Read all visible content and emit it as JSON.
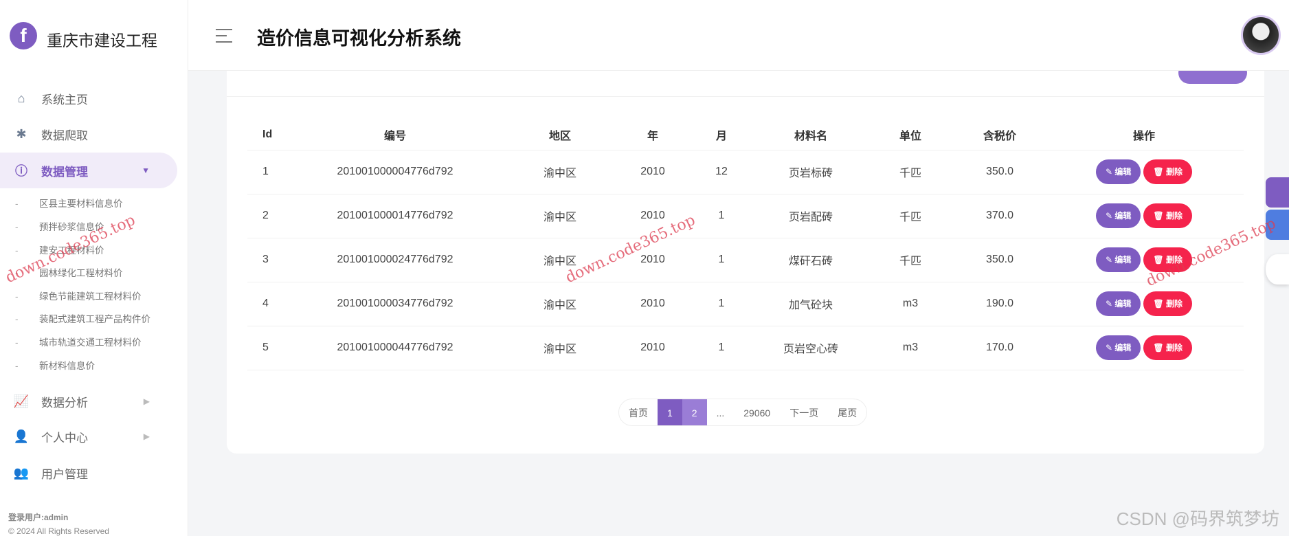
{
  "sidebar": {
    "logo_letter": "f",
    "brand": "重庆市建设工程",
    "items": [
      {
        "label": "系统主页"
      },
      {
        "label": "数据爬取"
      },
      {
        "label": "数据管理"
      },
      {
        "label": "数据分析"
      },
      {
        "label": "个人中心"
      },
      {
        "label": "用户管理"
      }
    ],
    "submenu": [
      "区县主要材料信息价",
      "预拌砂浆信息价",
      "建安工程材料价",
      "园林绿化工程材料价",
      "绿色节能建筑工程材料价",
      "装配式建筑工程产品构件价",
      "城市轨道交通工程材料价",
      "新材料信息价"
    ],
    "login_user": "登录用户:admin",
    "copyright": "© 2024 All Rights Reserved"
  },
  "header": {
    "title": "造价信息可视化分析系统"
  },
  "table": {
    "columns": [
      "Id",
      "编号",
      "地区",
      "年",
      "月",
      "材料名",
      "单位",
      "含税价",
      "操作"
    ],
    "rows": [
      [
        "1",
        "201001000004776d792",
        "渝中区",
        "2010",
        "12",
        "页岩标砖",
        "千匹",
        "350.0"
      ],
      [
        "2",
        "201001000014776d792",
        "渝中区",
        "2010",
        "1",
        "页岩配砖",
        "千匹",
        "370.0"
      ],
      [
        "3",
        "201001000024776d792",
        "渝中区",
        "2010",
        "1",
        "煤矸石砖",
        "千匹",
        "350.0"
      ],
      [
        "4",
        "201001000034776d792",
        "渝中区",
        "2010",
        "1",
        "加气砼块",
        "m3",
        "190.0"
      ],
      [
        "5",
        "201001000044776d792",
        "渝中区",
        "2010",
        "1",
        "页岩空心砖",
        "m3",
        "170.0"
      ]
    ],
    "edit_label": "✎ 编辑",
    "delete_label": "🗑 删除"
  },
  "pager": {
    "first": "首页",
    "pages": [
      "1",
      "2"
    ],
    "ellipsis": "...",
    "last_page": "29060",
    "next": "下一页",
    "end": "尾页"
  },
  "watermark": "down.code365.top",
  "csdn": "CSDN @码界筑梦坊"
}
